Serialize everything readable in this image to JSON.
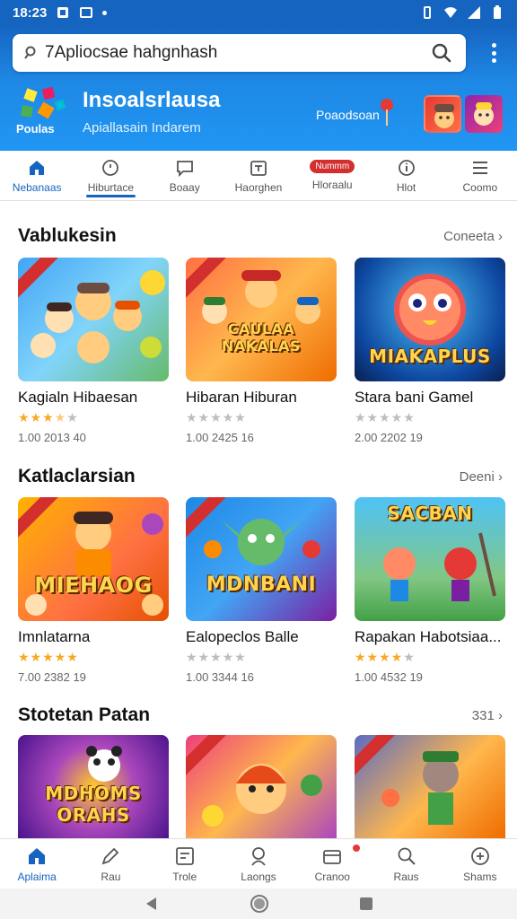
{
  "status_bar": {
    "time": "18:23"
  },
  "search": {
    "query": "7Apliocsae hahgnhash"
  },
  "banner": {
    "logo_label": "Poulas",
    "title": "Insoalsrlausa",
    "subtitle": "Apiallasain Indarem",
    "promo_text": "Poaodsoan"
  },
  "tabs": [
    {
      "label": "Nebanaas",
      "icon": "home-icon"
    },
    {
      "label": "Hiburtace",
      "icon": "timer-icon"
    },
    {
      "label": "Boaay",
      "icon": "chat-icon"
    },
    {
      "label": "Haorghen",
      "icon": "calendar-icon"
    },
    {
      "label": "Hloraalu",
      "icon": "tag-icon",
      "pill": "Nummm"
    },
    {
      "label": "Hlot",
      "icon": "info-icon"
    },
    {
      "label": "Coomo",
      "icon": "menu-icon"
    }
  ],
  "sections": [
    {
      "title": "Vablukesin",
      "link": "Coneeta",
      "cards": [
        {
          "title": "Kagialn Hibaesan",
          "rating": 3.5,
          "meta": "1.00 2013 40",
          "art_label": ""
        },
        {
          "title": "Hibaran Hiburan",
          "rating": 0,
          "meta": "1.00 2425 16",
          "art_label": "CAULAA NAKALAS"
        },
        {
          "title": "Stara bani Gamel",
          "rating": 0,
          "meta": "2.00 2202 19",
          "art_label": "MIAKAPLUS"
        }
      ]
    },
    {
      "title": "Katlaclarsian",
      "link": "Deeni",
      "cards": [
        {
          "title": "Imnlatarna",
          "rating": 5,
          "meta": "7.00 2382 19",
          "art_label": "MIEHAOG"
        },
        {
          "title": "Ealopeclos Balle",
          "rating": 0,
          "meta": "1.00 3344 16",
          "art_label": "MDNBANI"
        },
        {
          "title": "Rapakan Habotsiaa...",
          "rating": 4,
          "meta": "1.00 4532 19",
          "art_label": "SACBAN"
        }
      ]
    },
    {
      "title": "Stotetan Patan",
      "link": "331",
      "cards": [
        {
          "art_label": "MDHOMS ORAHS"
        },
        {
          "art_label": ""
        },
        {
          "art_label": ""
        }
      ]
    }
  ],
  "bottom_nav": [
    {
      "label": "Aplaima",
      "icon": "home-icon"
    },
    {
      "label": "Rau",
      "icon": "pen-icon"
    },
    {
      "label": "Trole",
      "icon": "grid-icon"
    },
    {
      "label": "Laongs",
      "icon": "person-icon"
    },
    {
      "label": "Cranoo",
      "icon": "wallet-icon"
    },
    {
      "label": "Raus",
      "icon": "search-icon"
    },
    {
      "label": "Shams",
      "icon": "plus-circle-icon"
    }
  ],
  "colors": {
    "primary": "#1565c0",
    "star": "#f9a825",
    "badge": "#d32f2f"
  }
}
